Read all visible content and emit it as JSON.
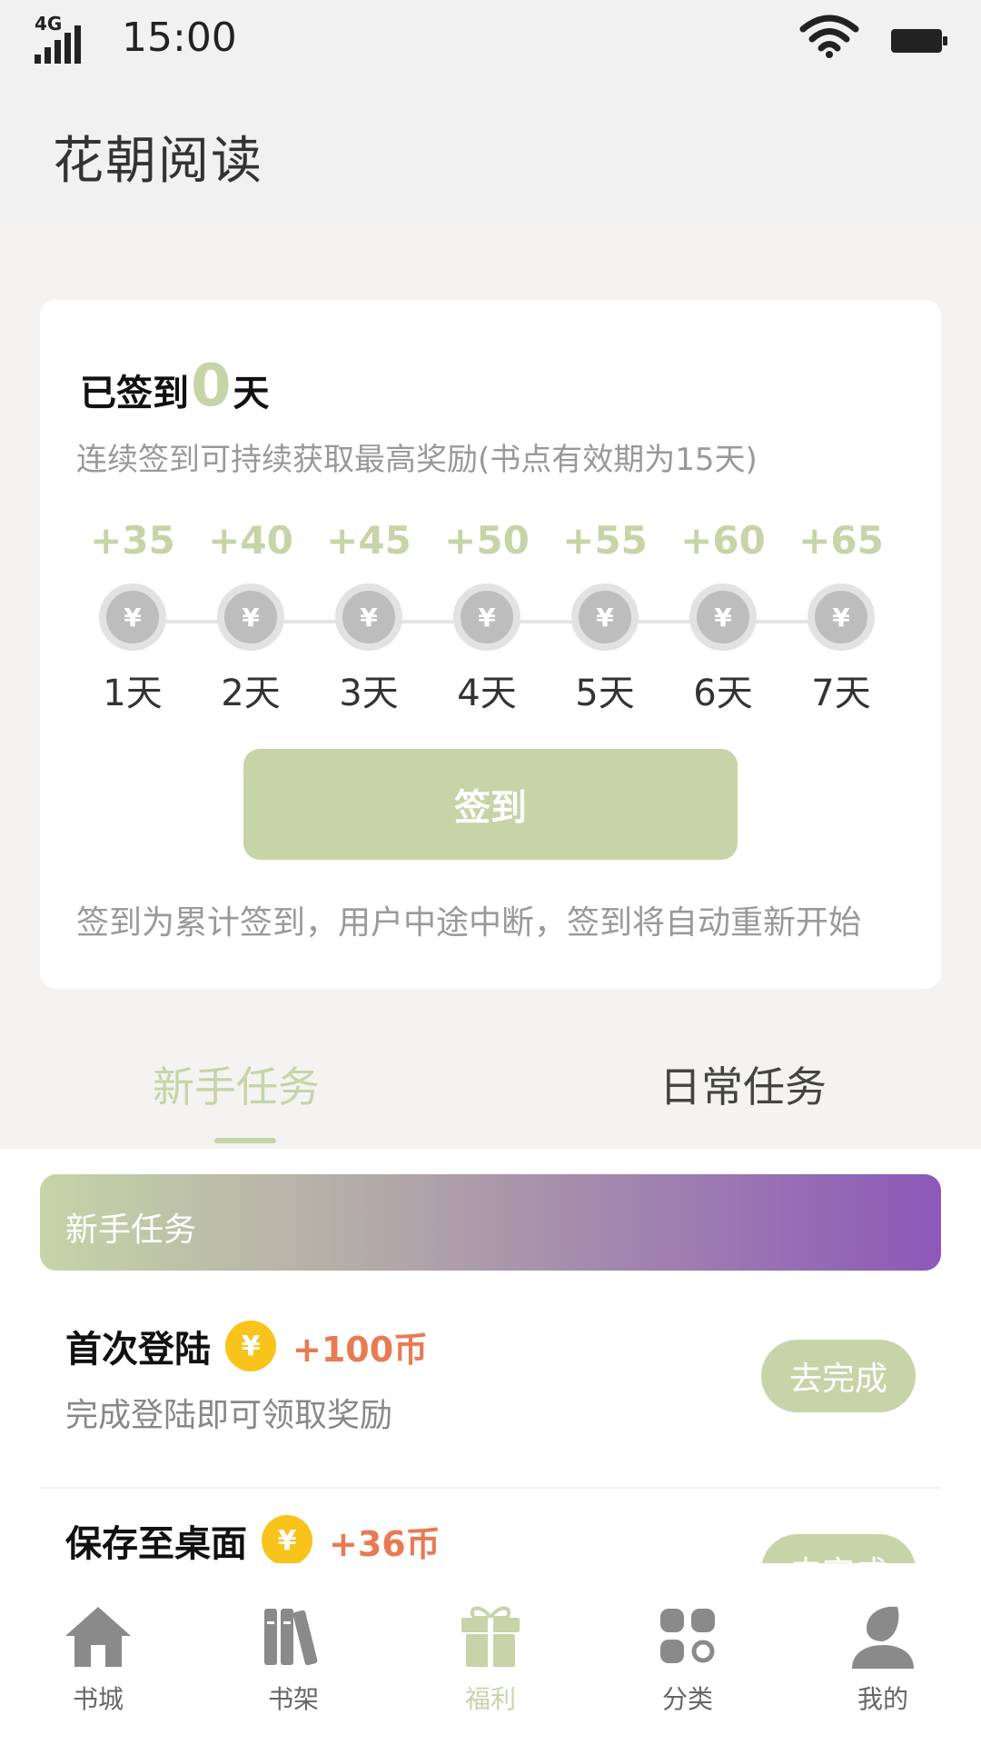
{
  "status_bar": {
    "network": "4G",
    "time": "15:00"
  },
  "header": {
    "title": "花朝阅读"
  },
  "signin": {
    "prefix": "已签到",
    "count": "0",
    "suffix": "天",
    "description": "连续签到可持续获取最高奖励(书点有效期为15天)",
    "days": [
      {
        "reward": "+35",
        "label": "1天"
      },
      {
        "reward": "+40",
        "label": "2天"
      },
      {
        "reward": "+45",
        "label": "3天"
      },
      {
        "reward": "+50",
        "label": "4天"
      },
      {
        "reward": "+55",
        "label": "5天"
      },
      {
        "reward": "+60",
        "label": "6天"
      },
      {
        "reward": "+65",
        "label": "7天"
      }
    ],
    "coin_symbol": "¥",
    "button_label": "签到",
    "note": "签到为累计签到，用户中途中断，签到将自动重新开始"
  },
  "tabs": [
    {
      "label": "新手任务",
      "active": true
    },
    {
      "label": "日常任务",
      "active": false
    }
  ],
  "task_section": {
    "banner_title": "新手任务",
    "tasks": [
      {
        "name": "首次登陆",
        "reward": "+100币",
        "description": "完成登陆即可领取奖励",
        "button": "去完成"
      },
      {
        "name": "保存至桌面",
        "reward": "+36币",
        "description": "",
        "button": "去完成"
      }
    ]
  },
  "bottom_nav": [
    {
      "label": "书城",
      "icon": "home-icon",
      "active": false
    },
    {
      "label": "书架",
      "icon": "bookshelf-icon",
      "active": false
    },
    {
      "label": "福利",
      "icon": "gift-icon",
      "active": true
    },
    {
      "label": "分类",
      "icon": "category-icon",
      "active": false
    },
    {
      "label": "我的",
      "icon": "profile-icon",
      "active": false
    }
  ],
  "colors": {
    "accent": "#c6d4a8",
    "reward_orange": "#e97a53",
    "coin_gold": "#f8c41c",
    "banner_end": "#8d58b8"
  }
}
